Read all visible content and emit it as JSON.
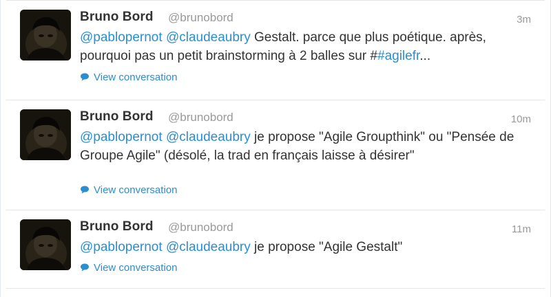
{
  "colors": {
    "link": "#2b8ed0",
    "name": "#333333",
    "muted": "#999999",
    "divider": "#e6e6e6"
  },
  "icons": {
    "avatar": "user-avatar",
    "conversation": "speech-bubble-icon"
  },
  "tweets": [
    {
      "fullname": "Bruno Bord",
      "username": "@brunobord",
      "time": "3m",
      "mention1": "@pablopernot",
      "mention2": "@claudeaubry",
      "text": " Gestalt. parce que plus poétique. après, pourquoi pas un petit brainstorming à 2 balles sur ",
      "hash_prefix": "#",
      "hashtag": "#agilefr",
      "ellipsis": "...",
      "view_conversation": "View conversation"
    },
    {
      "fullname": "Bruno Bord",
      "username": "@brunobord",
      "time": "10m",
      "mention1": "@pablopernot",
      "mention2": "@claudeaubry",
      "text": " je propose \"Agile Groupthink\" ou \"Pensée de Groupe Agile\" (désolé, la trad en français laisse à désirer\"",
      "view_conversation": "View conversation"
    },
    {
      "fullname": "Bruno Bord",
      "username": "@brunobord",
      "time": "11m",
      "mention1": "@pablopernot",
      "mention2": "@claudeaubry",
      "text": " je propose \"Agile Gestalt\"",
      "view_conversation": "View conversation"
    }
  ]
}
